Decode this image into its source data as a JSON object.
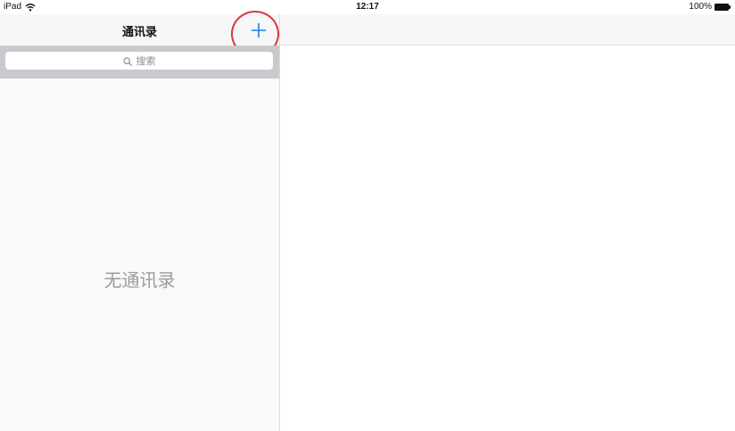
{
  "status_bar": {
    "device": "iPad",
    "time": "12:17",
    "battery": "100%"
  },
  "master": {
    "title": "通讯录",
    "add_button_label": "+",
    "search": {
      "placeholder": "搜索"
    },
    "empty_message": "无通讯录"
  },
  "colors": {
    "accent": "#1a7cf5",
    "highlight_circle": "#d9363e",
    "search_bar_bg": "#c9c9ce",
    "empty_text": "#9b9b9b"
  },
  "icons": {
    "wifi": "wifi-icon",
    "battery": "battery-icon",
    "search": "search-icon",
    "add": "plus-icon"
  }
}
